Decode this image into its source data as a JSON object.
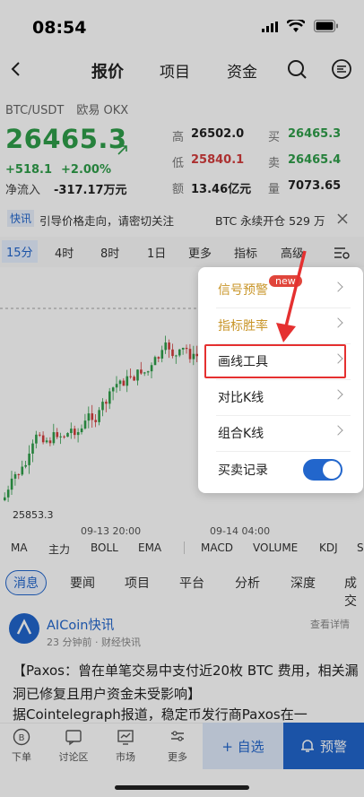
{
  "status": {
    "time": "08:54"
  },
  "nav": {
    "tabs": [
      "报价",
      "项目",
      "资金"
    ]
  },
  "pair": {
    "symbol": "BTC/USDT",
    "exchange": "欧易 OKX"
  },
  "price": {
    "last": "26465.3",
    "change": "+518.1",
    "change_pct": "+2.00%",
    "inflow_label": "净流入",
    "inflow_value": "-317.17万元"
  },
  "stats": [
    {
      "label": "高",
      "value": "26502.0",
      "color": "#222222"
    },
    {
      "label": "买",
      "value": "26465.3",
      "color": "#2f9e4a"
    },
    {
      "label": "低",
      "value": "25840.1",
      "color": "#d23c3c"
    },
    {
      "label": "卖",
      "value": "26465.4",
      "color": "#2f9e4a"
    },
    {
      "label": "额",
      "value": "13.46亿元",
      "color": "#222222"
    },
    {
      "label": "量",
      "value": "7073.65",
      "color": "#222222"
    }
  ],
  "ticker": {
    "badge": "快讯",
    "text1": "引导价格走向，请密切关注",
    "text2": "BTC 永续开仓 529 万"
  },
  "timeframes": [
    "15分",
    "4时",
    "8时",
    "1日",
    "更多",
    "指标",
    "高级"
  ],
  "chart": {
    "low_label": "25853.3",
    "x_labels": [
      "09-13 20:00",
      "09-14 04:00"
    ]
  },
  "indicators": [
    "MA",
    "主力",
    "BOLL",
    "EMA",
    "MACD",
    "VOLUME",
    "KDJ",
    "S"
  ],
  "news_tabs": [
    "消息",
    "要闻",
    "项目",
    "平台",
    "分析",
    "深度",
    "成交"
  ],
  "feed": {
    "source": "AICoin快讯",
    "meta": "23 分钟前 · 财经快讯",
    "detail": "查看详情",
    "title": "【Paxos：曾在单笔交易中支付近20枚 BTC 费用，相关漏洞已修复且用户资金未受影响】",
    "body": "据Cointelegraph报道，稳定币发行商Paxos在一"
  },
  "bottom_nav": [
    {
      "label": "下单",
      "icon": "bitcoin-icon"
    },
    {
      "label": "讨论区",
      "icon": "chat-icon"
    },
    {
      "label": "市场",
      "icon": "market-icon"
    },
    {
      "label": "更多",
      "icon": "more-icon"
    }
  ],
  "actions": {
    "watch": "+ 自选",
    "alert": "预警"
  },
  "menu": {
    "items": [
      {
        "label": "信号预警",
        "gold": true
      },
      {
        "label": "指标胜率",
        "gold": true
      },
      {
        "label": "画线工具",
        "gold": false
      },
      {
        "label": "对比K线",
        "gold": false
      },
      {
        "label": "组合K线",
        "gold": false
      },
      {
        "label": "买卖记录",
        "gold": false
      }
    ],
    "new_badge": "new",
    "toggle_on": true
  },
  "colors": {
    "accent": "#2266cc",
    "up": "#2f9e4a",
    "down": "#d23c3c",
    "highlight": "#e53030"
  }
}
